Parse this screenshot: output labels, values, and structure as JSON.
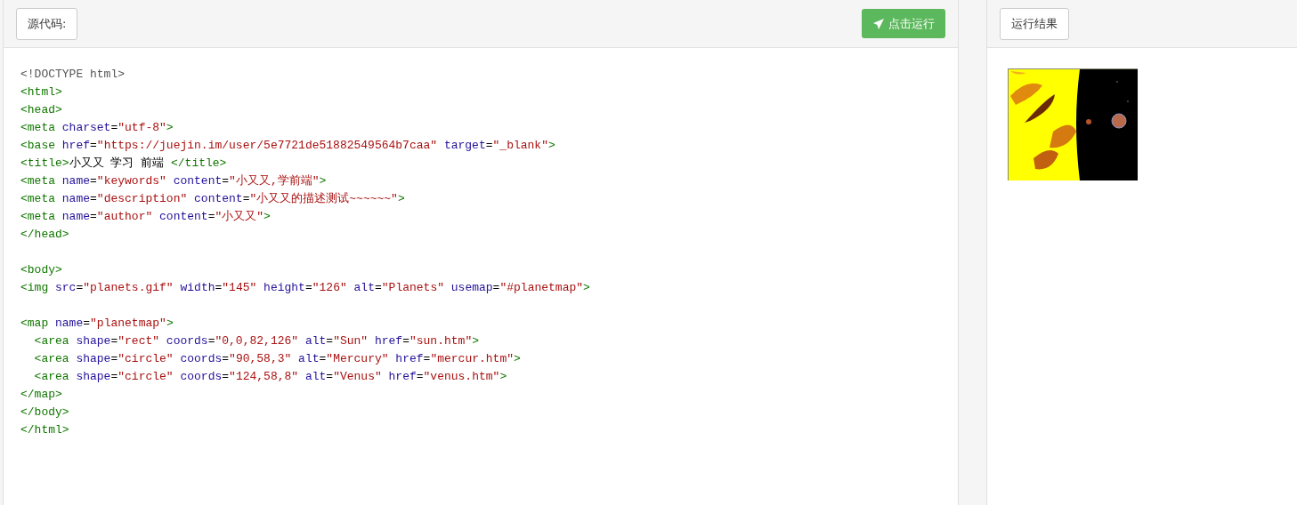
{
  "editor": {
    "label": "源代码:",
    "run_button": "点击运行",
    "lines": [
      {
        "tokens": [
          {
            "kind": "meta",
            "text": "<!DOCTYPE html>"
          }
        ]
      },
      {
        "tokens": [
          {
            "kind": "tag",
            "text": "<html>"
          }
        ]
      },
      {
        "tokens": [
          {
            "kind": "tag",
            "text": "<head>"
          }
        ]
      },
      {
        "tokens": [
          {
            "kind": "tag",
            "text": "<meta"
          },
          {
            "kind": "attr",
            "text": " charset"
          },
          {
            "kind": "plain",
            "text": "="
          },
          {
            "kind": "string",
            "text": "\"utf-8\""
          },
          {
            "kind": "tag",
            "text": ">"
          }
        ]
      },
      {
        "tokens": [
          {
            "kind": "tag",
            "text": "<base"
          },
          {
            "kind": "attr",
            "text": " href"
          },
          {
            "kind": "plain",
            "text": "="
          },
          {
            "kind": "string",
            "text": "\"https://juejin.im/user/5e7721de51882549564b7caa\""
          },
          {
            "kind": "attr",
            "text": " target"
          },
          {
            "kind": "plain",
            "text": "="
          },
          {
            "kind": "string",
            "text": "\"_blank\""
          },
          {
            "kind": "tag",
            "text": ">"
          }
        ]
      },
      {
        "tokens": [
          {
            "kind": "tag",
            "text": "<title>"
          },
          {
            "kind": "plain",
            "text": "小又又 学习 前端 "
          },
          {
            "kind": "tag",
            "text": "</title>"
          }
        ]
      },
      {
        "tokens": [
          {
            "kind": "tag",
            "text": "<meta"
          },
          {
            "kind": "attr",
            "text": " name"
          },
          {
            "kind": "plain",
            "text": "="
          },
          {
            "kind": "string",
            "text": "\"keywords\""
          },
          {
            "kind": "attr",
            "text": " content"
          },
          {
            "kind": "plain",
            "text": "="
          },
          {
            "kind": "string",
            "text": "\"小又又,学前端\""
          },
          {
            "kind": "tag",
            "text": ">"
          }
        ]
      },
      {
        "tokens": [
          {
            "kind": "tag",
            "text": "<meta"
          },
          {
            "kind": "attr",
            "text": " name"
          },
          {
            "kind": "plain",
            "text": "="
          },
          {
            "kind": "string",
            "text": "\"description\""
          },
          {
            "kind": "attr",
            "text": " content"
          },
          {
            "kind": "plain",
            "text": "="
          },
          {
            "kind": "string",
            "text": "\"小又又的描述测试~~~~~~\""
          },
          {
            "kind": "tag",
            "text": ">"
          }
        ]
      },
      {
        "tokens": [
          {
            "kind": "tag",
            "text": "<meta"
          },
          {
            "kind": "attr",
            "text": " name"
          },
          {
            "kind": "plain",
            "text": "="
          },
          {
            "kind": "string",
            "text": "\"author\""
          },
          {
            "kind": "attr",
            "text": " content"
          },
          {
            "kind": "plain",
            "text": "="
          },
          {
            "kind": "string",
            "text": "\"小又又\""
          },
          {
            "kind": "tag",
            "text": ">"
          }
        ]
      },
      {
        "tokens": [
          {
            "kind": "tag",
            "text": "</head>"
          }
        ]
      },
      {
        "kind": "blank"
      },
      {
        "tokens": [
          {
            "kind": "tag",
            "text": "<body>"
          }
        ]
      },
      {
        "tokens": [
          {
            "kind": "tag",
            "text": "<img"
          },
          {
            "kind": "attr",
            "text": " src"
          },
          {
            "kind": "plain",
            "text": "="
          },
          {
            "kind": "string",
            "text": "\"planets.gif\""
          },
          {
            "kind": "attr",
            "text": " width"
          },
          {
            "kind": "plain",
            "text": "="
          },
          {
            "kind": "string",
            "text": "\"145\""
          },
          {
            "kind": "attr",
            "text": " height"
          },
          {
            "kind": "plain",
            "text": "="
          },
          {
            "kind": "string",
            "text": "\"126\""
          },
          {
            "kind": "attr",
            "text": " alt"
          },
          {
            "kind": "plain",
            "text": "="
          },
          {
            "kind": "string",
            "text": "\"Planets\""
          },
          {
            "kind": "attr",
            "text": " usemap"
          },
          {
            "kind": "plain",
            "text": "="
          },
          {
            "kind": "string",
            "text": "\"#planetmap\""
          },
          {
            "kind": "tag",
            "text": ">"
          }
        ]
      },
      {
        "kind": "blank"
      },
      {
        "tokens": [
          {
            "kind": "tag",
            "text": "<map"
          },
          {
            "kind": "attr",
            "text": " name"
          },
          {
            "kind": "plain",
            "text": "="
          },
          {
            "kind": "string",
            "text": "\"planetmap\""
          },
          {
            "kind": "tag",
            "text": ">"
          }
        ]
      },
      {
        "tokens": [
          {
            "kind": "tag",
            "text": "  <area"
          },
          {
            "kind": "attr",
            "text": " shape"
          },
          {
            "kind": "plain",
            "text": "="
          },
          {
            "kind": "string",
            "text": "\"rect\""
          },
          {
            "kind": "attr",
            "text": " coords"
          },
          {
            "kind": "plain",
            "text": "="
          },
          {
            "kind": "string",
            "text": "\"0,0,82,126\""
          },
          {
            "kind": "attr",
            "text": " alt"
          },
          {
            "kind": "plain",
            "text": "="
          },
          {
            "kind": "string",
            "text": "\"Sun\""
          },
          {
            "kind": "attr",
            "text": " href"
          },
          {
            "kind": "plain",
            "text": "="
          },
          {
            "kind": "string",
            "text": "\"sun.htm\""
          },
          {
            "kind": "tag",
            "text": ">"
          }
        ]
      },
      {
        "tokens": [
          {
            "kind": "tag",
            "text": "  <area"
          },
          {
            "kind": "attr",
            "text": " shape"
          },
          {
            "kind": "plain",
            "text": "="
          },
          {
            "kind": "string",
            "text": "\"circle\""
          },
          {
            "kind": "attr",
            "text": " coords"
          },
          {
            "kind": "plain",
            "text": "="
          },
          {
            "kind": "string",
            "text": "\"90,58,3\""
          },
          {
            "kind": "attr",
            "text": " alt"
          },
          {
            "kind": "plain",
            "text": "="
          },
          {
            "kind": "string",
            "text": "\"Mercury\""
          },
          {
            "kind": "attr",
            "text": " href"
          },
          {
            "kind": "plain",
            "text": "="
          },
          {
            "kind": "string",
            "text": "\"mercur.htm\""
          },
          {
            "kind": "tag",
            "text": ">"
          }
        ]
      },
      {
        "tokens": [
          {
            "kind": "tag",
            "text": "  <area"
          },
          {
            "kind": "attr",
            "text": " shape"
          },
          {
            "kind": "plain",
            "text": "="
          },
          {
            "kind": "string",
            "text": "\"circle\""
          },
          {
            "kind": "attr",
            "text": " coords"
          },
          {
            "kind": "plain",
            "text": "="
          },
          {
            "kind": "string",
            "text": "\"124,58,8\""
          },
          {
            "kind": "attr",
            "text": " alt"
          },
          {
            "kind": "plain",
            "text": "="
          },
          {
            "kind": "string",
            "text": "\"Venus\""
          },
          {
            "kind": "attr",
            "text": " href"
          },
          {
            "kind": "plain",
            "text": "="
          },
          {
            "kind": "string",
            "text": "\"venus.htm\""
          },
          {
            "kind": "tag",
            "text": ">"
          }
        ]
      },
      {
        "tokens": [
          {
            "kind": "tag",
            "text": "</map>"
          }
        ]
      },
      {
        "tokens": [
          {
            "kind": "tag",
            "text": "</body>"
          }
        ]
      },
      {
        "tokens": [
          {
            "kind": "tag",
            "text": "</html>"
          }
        ]
      }
    ]
  },
  "result": {
    "label": "运行结果"
  }
}
